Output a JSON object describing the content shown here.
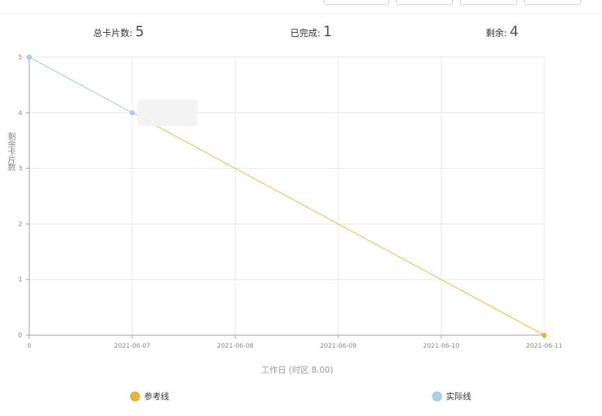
{
  "stats": {
    "total_label": "总卡片数:",
    "total_value": "5",
    "done_label": "已完成:",
    "done_value": "1",
    "remaining_label": "剩余:",
    "remaining_value": "4"
  },
  "colors": {
    "reference_line": "#e8b634",
    "actual_line": "#a9d0ee",
    "actual_stroke": "#9ec5d6",
    "grid": "#e6e6e6",
    "axis": "#999999"
  },
  "chart_data": {
    "type": "line",
    "xlabel": "工作日 (时区 8.00)",
    "ylabel": "剩余卡片数",
    "x_ticks": [
      "0",
      "2021-06-07",
      "2021-06-08",
      "2021-06-09",
      "2021-06-10",
      "2021-06-11"
    ],
    "y_ticks": [
      "0",
      "1",
      "2",
      "3",
      "4",
      "5"
    ],
    "ylim": [
      0,
      5
    ],
    "grid": true,
    "legend_position": "bottom",
    "series": [
      {
        "name": "参考线",
        "points": [
          {
            "x": "2021-06-07",
            "y": 4
          },
          {
            "x": "2021-06-11",
            "y": 0
          }
        ]
      },
      {
        "name": "实际线",
        "points": [
          {
            "x": "0",
            "y": 5
          },
          {
            "x": "2021-06-07",
            "y": 4
          }
        ]
      }
    ]
  },
  "legend": {
    "reference_label": "参考线",
    "actual_label": "实际线"
  }
}
